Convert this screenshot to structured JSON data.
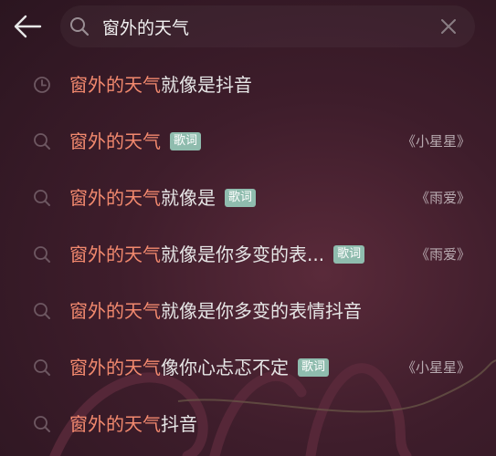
{
  "search": {
    "query": "窗外的天气",
    "placeholder": ""
  },
  "suggestions": [
    {
      "icon": "history-icon",
      "highlight": "窗外的天气",
      "rest": "就像是抖音",
      "badge": "",
      "artist": ""
    },
    {
      "icon": "search-icon",
      "highlight": "窗外的天气",
      "rest": "",
      "badge": "歌词",
      "artist": "《小星星》"
    },
    {
      "icon": "search-icon",
      "highlight": "窗外的天气",
      "rest": "就像是",
      "badge": "歌词",
      "artist": "《雨爱》"
    },
    {
      "icon": "search-icon",
      "highlight": "窗外的天气",
      "rest": "就像是你多变的表...",
      "badge": "歌词",
      "artist": "《雨爱》"
    },
    {
      "icon": "search-icon",
      "highlight": "窗外的天气",
      "rest": "就像是你多变的表情抖音",
      "badge": "",
      "artist": ""
    },
    {
      "icon": "search-icon",
      "highlight": "窗外的天气",
      "rest": "像你心忐忑不定",
      "badge": "歌词",
      "artist": "《小星星》"
    },
    {
      "icon": "search-icon",
      "highlight": "窗外的天气",
      "rest": "抖音",
      "badge": "",
      "artist": ""
    }
  ],
  "colors": {
    "highlight": "#f2896e",
    "badge": "#8fbcae",
    "text": "#e6e6e6",
    "artist": "#b8aab0"
  }
}
